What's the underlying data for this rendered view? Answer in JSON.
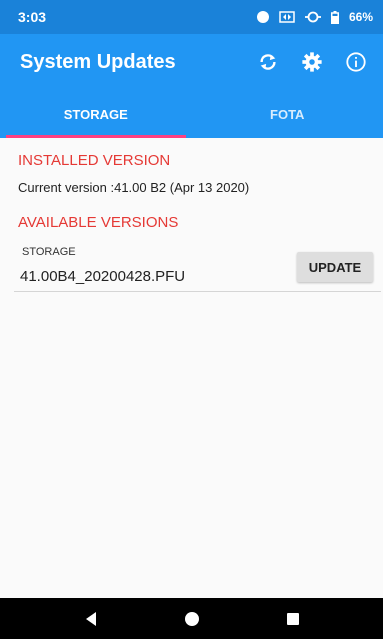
{
  "status_bar": {
    "time": "3:03",
    "battery": "66%"
  },
  "app_bar": {
    "title": "System Updates"
  },
  "tabs": [
    {
      "label": "STORAGE",
      "active": true
    },
    {
      "label": "FOTA",
      "active": false
    }
  ],
  "installed": {
    "heading": "INSTALLED VERSION",
    "current": "Current version :41.00 B2 (Apr 13 2020)"
  },
  "available": {
    "heading": "AVAILABLE VERSIONS",
    "items": [
      {
        "source": "STORAGE",
        "file": "41.00B4_20200428.PFU",
        "button": "UPDATE"
      }
    ]
  },
  "colors": {
    "primary": "#2196f3",
    "status_bar": "#1a82d9",
    "accent": "#ff4081",
    "heading": "#e53935"
  },
  "icons": [
    "refresh-icon",
    "settings-gear-icon",
    "info-icon",
    "back-icon",
    "home-icon",
    "recents-icon"
  ]
}
